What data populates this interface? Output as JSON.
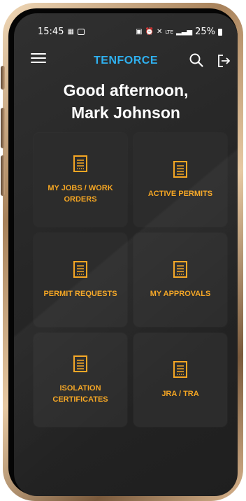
{
  "status_bar": {
    "time": "15:45",
    "battery": "25%",
    "network": "LTE"
  },
  "app_bar": {
    "brand": "TENFORCE"
  },
  "greeting": {
    "line1": "Good afternoon,",
    "line2": "Mark Johnson"
  },
  "tiles": [
    {
      "label": "MY JOBS / WORK ORDERS",
      "icon": "document-icon"
    },
    {
      "label": "ACTIVE PERMITS",
      "icon": "document-icon"
    },
    {
      "label": "PERMIT REQUESTS",
      "icon": "document-icon"
    },
    {
      "label": "MY APPROVALS",
      "icon": "document-icon"
    },
    {
      "label": "ISOLATION CERTIFICATES",
      "icon": "document-icon"
    },
    {
      "label": "JRA / TRA",
      "icon": "document-icon"
    }
  ],
  "colors": {
    "accent": "#f5a623",
    "brand": "#2fb1f0",
    "background": "#262626",
    "tile": "#2c2c2c"
  }
}
